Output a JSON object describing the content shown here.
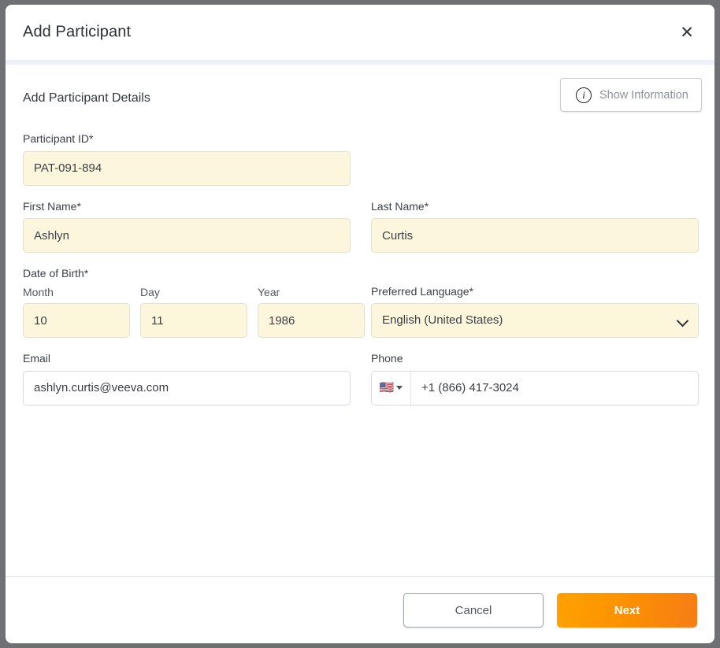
{
  "dialog": {
    "title": "Add Participant",
    "close_icon": "close-icon",
    "section_heading": "Add Participant Details",
    "show_information": {
      "label": "Show Information",
      "icon": "info-circle-icon"
    }
  },
  "form": {
    "participant_id": {
      "label": "Participant ID*",
      "value": "PAT-091-894",
      "placeholder": ""
    },
    "first_name": {
      "label": "First Name*",
      "value": "Ashlyn",
      "placeholder": ""
    },
    "last_name": {
      "label": "Last Name*",
      "value": "Curtis",
      "placeholder": ""
    },
    "date_of_birth": {
      "label": "Date of Birth*",
      "month": {
        "label": "Month",
        "value": "10",
        "placeholder": ""
      },
      "day": {
        "label": "Day",
        "value": "11",
        "placeholder": ""
      },
      "year": {
        "label": "Year",
        "value": "1986",
        "placeholder": ""
      }
    },
    "preferred_language": {
      "label": "Preferred Language*",
      "value": "English (United States)",
      "chevron_icon": "chevron-down-icon"
    },
    "email": {
      "label": "Email",
      "value": "ashlyn.curtis@veeva.com",
      "placeholder": ""
    },
    "phone": {
      "label": "Phone",
      "country_flag": "🇺🇸",
      "country_flag_name": "us-flag-icon",
      "value": "+1 (866) 417-3024",
      "placeholder": ""
    }
  },
  "footer": {
    "cancel_label": "Cancel",
    "next_label": "Next"
  },
  "colors": {
    "accent_orange_start": "#FFA200",
    "accent_orange_end": "#F57D16",
    "required_field_bg": "#FCF6DD",
    "backdrop": "#6E7074"
  }
}
